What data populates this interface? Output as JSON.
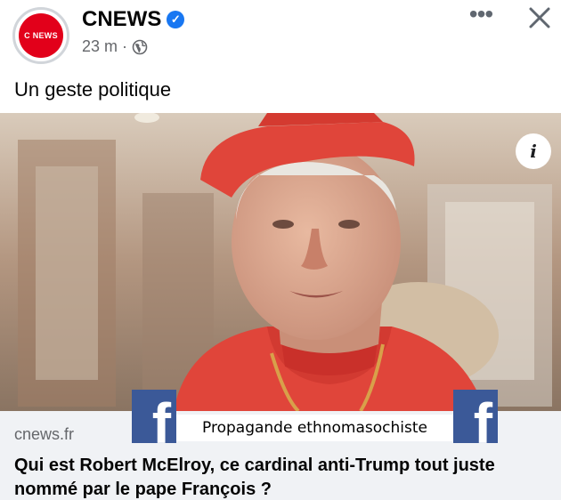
{
  "post": {
    "page_name": "CNEWS",
    "avatar_text": "C NEWS",
    "verified": true,
    "timestamp": "23 m",
    "separator": "·",
    "privacy_icon": "globe-icon",
    "more_icon": "more-horizontal-icon",
    "more_glyph": "•••",
    "close_icon": "close-icon",
    "text": "Un geste politique"
  },
  "image": {
    "info_icon": "info-icon",
    "info_glyph": "i"
  },
  "link": {
    "domain": "cnews.fr",
    "title": "Qui est Robert McElroy, ce cardinal anti-Trump tout juste nommé par le pape François ?"
  },
  "overlay": {
    "banner_text": "Propagande ethnomasochiste",
    "logo_glyph": "f",
    "logo_icon": "facebook-logo-icon"
  },
  "colors": {
    "brand_red": "#e2001a",
    "verified_blue": "#1877f2",
    "facebook_blue": "#3b5998",
    "muted_text": "#65676b",
    "link_footer_bg": "#f0f2f5",
    "cap_red": "#e0453a"
  }
}
